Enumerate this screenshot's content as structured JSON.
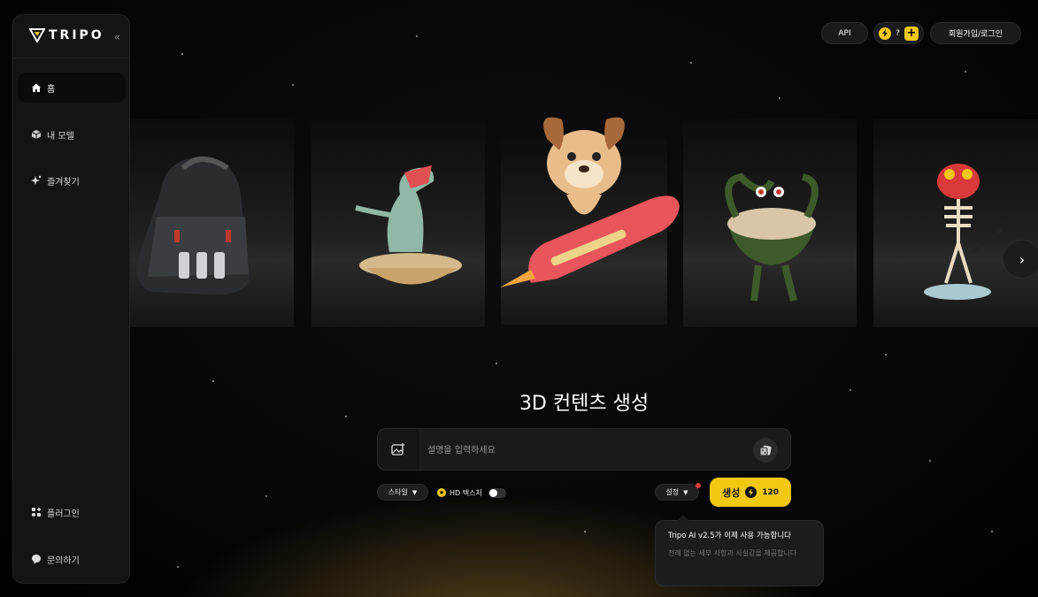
{
  "brand": {
    "name": "TRIPO"
  },
  "sidebar": {
    "collapse_icon": "double-chevron-left-icon",
    "top_items": [
      {
        "label": "홈",
        "icon": "home-icon",
        "active": true
      },
      {
        "label": "내 모델",
        "icon": "cube-icon",
        "active": false
      },
      {
        "label": "즐겨찾기",
        "icon": "sparkle-icon",
        "active": false
      }
    ],
    "bottom_items": [
      {
        "label": "플러그인",
        "icon": "plugin-icon"
      },
      {
        "label": "문의하기",
        "icon": "chat-icon"
      }
    ]
  },
  "header": {
    "api_label": "API",
    "credits_value": "?",
    "add_credits_label": "+",
    "login_label": "회원가입/로그인"
  },
  "carousel": {
    "items": [
      "backpack-model",
      "dinosaur-model",
      "dog-on-rocket-model",
      "cereal-bowl-creature-model",
      "skeleton-frog-model"
    ],
    "next_icon": "chevron-right-icon"
  },
  "generator": {
    "title": "3D 컨텐츠 생성",
    "prompt_placeholder": "설명을 입력하세요",
    "style_label": "스타일",
    "hd_texture_label": "HD 텍스처",
    "hd_texture_enabled": false,
    "settings_label": "설정",
    "generate_label": "생성",
    "generate_cost": "120"
  },
  "tooltip": {
    "title": "Tripo AI v2.5가 이제 사용 가능합니다",
    "description": "전례 없는 세부 사항과 사실감을 제공합니다"
  },
  "colors": {
    "accent": "#f2c811",
    "sidebar_bg": "#141414",
    "notification": "#e23a3a"
  }
}
